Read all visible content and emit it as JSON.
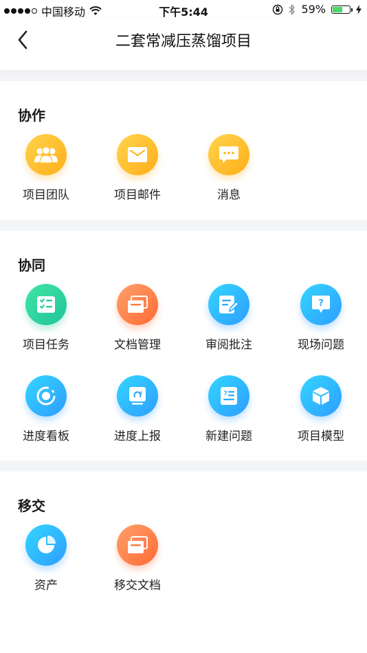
{
  "status_bar": {
    "carrier": "中国移动",
    "time": "下午5:44",
    "battery": "59%",
    "battery_level": 0.59,
    "battery_color": "#4cd964"
  },
  "nav": {
    "title": "二套常减压蒸馏项目",
    "back_icon": "chevron-left-icon"
  },
  "sections": {
    "collab": {
      "title": "协作",
      "items": [
        {
          "label": "项目团队",
          "icon": "team-icon"
        },
        {
          "label": "项目邮件",
          "icon": "mail-icon"
        },
        {
          "label": "消息",
          "icon": "message-icon"
        }
      ]
    },
    "cowork": {
      "title": "协同",
      "items": [
        {
          "label": "项目任务",
          "icon": "task-list-icon"
        },
        {
          "label": "文档管理",
          "icon": "documents-icon"
        },
        {
          "label": "审阅批注",
          "icon": "review-edit-icon"
        },
        {
          "label": "现场问题",
          "icon": "question-icon"
        },
        {
          "label": "进度看板",
          "icon": "progress-ring-icon"
        },
        {
          "label": "进度上报",
          "icon": "report-upload-icon"
        },
        {
          "label": "新建问题",
          "icon": "new-issue-icon"
        },
        {
          "label": "项目模型",
          "icon": "cube-icon"
        }
      ]
    },
    "handover": {
      "title": "移交",
      "items": [
        {
          "label": "资产",
          "icon": "pie-chart-icon"
        },
        {
          "label": "移交文档",
          "icon": "documents-icon"
        }
      ]
    }
  },
  "colors": {
    "yellow": "#ffb31f",
    "green": "#24c99c",
    "orange": "#ff7a3d",
    "blue": "#2ea9ff"
  }
}
